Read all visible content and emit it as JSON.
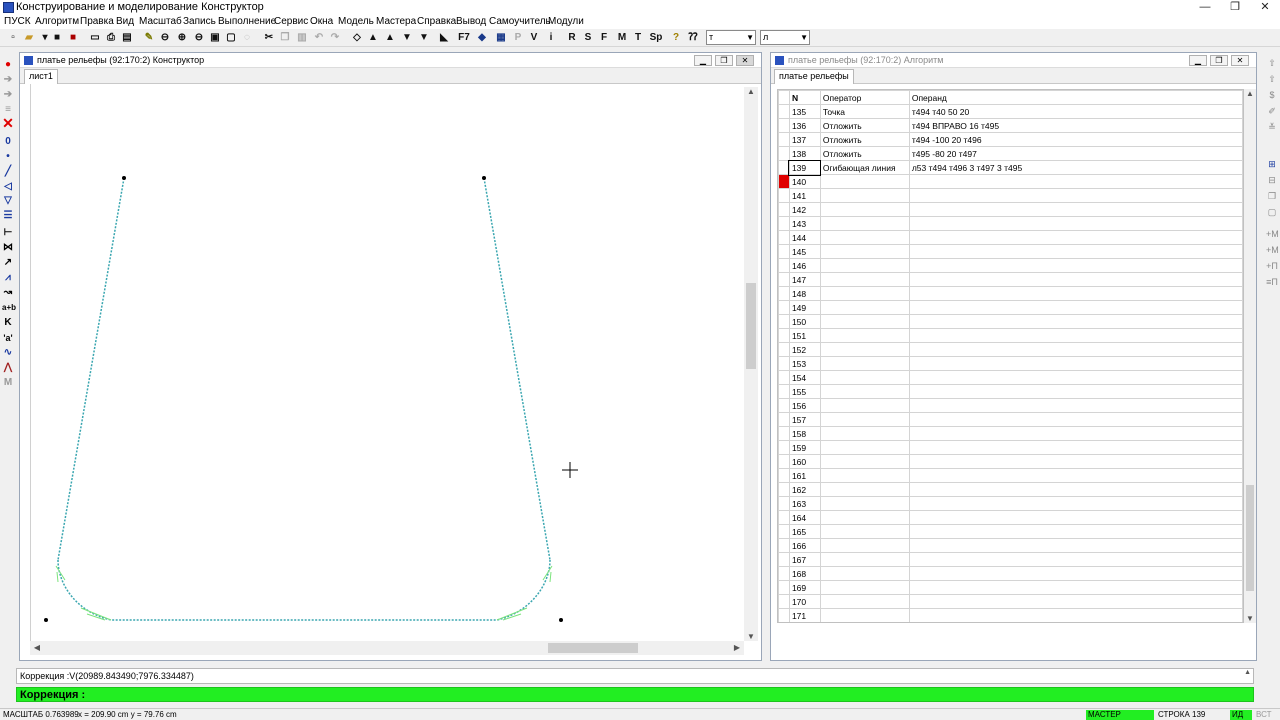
{
  "app": {
    "title": "Конструирование и моделирование  Конструктор"
  },
  "window_controls": {
    "minimize": "—",
    "restore": "❐",
    "close": "✕"
  },
  "menu": [
    "ПУСК",
    "Алгоритм",
    "Правка",
    "Вид",
    "Масштаб",
    "Запись",
    "Выполнение",
    "Сервис",
    "Окна",
    "Модель",
    "Мастера",
    "Справка",
    "Вывод",
    "Самоучитель",
    "Модули"
  ],
  "toolbar": {
    "letters": [
      "F7",
      "P",
      "V",
      "i",
      "R",
      "S",
      "F",
      "M",
      "T",
      "Sp"
    ],
    "select1": "т",
    "select2": "л"
  },
  "left_window": {
    "title": "платье рельефы (92:170:2) Конструктор",
    "tab": "лист1"
  },
  "right_window": {
    "title": "платье рельефы (92:170:2) Алгоритм",
    "tab": "платье рельефы",
    "columns": [
      "N",
      "Оператор",
      "Операнд"
    ],
    "rows": [
      {
        "n": "135",
        "op": "Точка",
        "operand": "т494 т40 50 20"
      },
      {
        "n": "136",
        "op": "Отложить",
        "operand": "т494 ВПРАВО 16 т495"
      },
      {
        "n": "137",
        "op": "Отложить",
        "operand": "т494 -100 20 т496"
      },
      {
        "n": "138",
        "op": "Отложить",
        "operand": "т495 -80 20 т497"
      },
      {
        "n": "139",
        "op": "Огибающая линия",
        "operand": "л53 т494 т496 3 т497 3 т495"
      },
      {
        "n": "140",
        "op": "",
        "operand": ""
      },
      {
        "n": "141",
        "op": "",
        "operand": ""
      },
      {
        "n": "142",
        "op": "",
        "operand": ""
      },
      {
        "n": "143",
        "op": "",
        "operand": ""
      },
      {
        "n": "144",
        "op": "",
        "operand": ""
      },
      {
        "n": "145",
        "op": "",
        "operand": ""
      },
      {
        "n": "146",
        "op": "",
        "operand": ""
      },
      {
        "n": "147",
        "op": "",
        "operand": ""
      },
      {
        "n": "148",
        "op": "",
        "operand": ""
      },
      {
        "n": "149",
        "op": "",
        "operand": ""
      },
      {
        "n": "150",
        "op": "",
        "operand": ""
      },
      {
        "n": "151",
        "op": "",
        "operand": ""
      },
      {
        "n": "152",
        "op": "",
        "operand": ""
      },
      {
        "n": "153",
        "op": "",
        "operand": ""
      },
      {
        "n": "154",
        "op": "",
        "operand": ""
      },
      {
        "n": "155",
        "op": "",
        "operand": ""
      },
      {
        "n": "156",
        "op": "",
        "operand": ""
      },
      {
        "n": "157",
        "op": "",
        "operand": ""
      },
      {
        "n": "158",
        "op": "",
        "operand": ""
      },
      {
        "n": "159",
        "op": "",
        "operand": ""
      },
      {
        "n": "160",
        "op": "",
        "operand": ""
      },
      {
        "n": "161",
        "op": "",
        "operand": ""
      },
      {
        "n": "162",
        "op": "",
        "operand": ""
      },
      {
        "n": "163",
        "op": "",
        "operand": ""
      },
      {
        "n": "164",
        "op": "",
        "operand": ""
      },
      {
        "n": "165",
        "op": "",
        "operand": ""
      },
      {
        "n": "166",
        "op": "",
        "operand": ""
      },
      {
        "n": "167",
        "op": "",
        "operand": ""
      },
      {
        "n": "168",
        "op": "",
        "operand": ""
      },
      {
        "n": "169",
        "op": "",
        "operand": ""
      },
      {
        "n": "170",
        "op": "",
        "operand": ""
      },
      {
        "n": "171",
        "op": "",
        "operand": ""
      }
    ]
  },
  "command": {
    "line1": "Коррекция :V(20989.843490;7976.334487)",
    "line2": "Коррекция :"
  },
  "status": {
    "scale": "МАСШТАБ 0.763989",
    "coords": "x = 209.90 cm  y = 79.76 cm",
    "master": "МАСТЕР",
    "row": "СТРОКА 139",
    "ind1": "ИД",
    "ind2": "ВСТ"
  },
  "colors": {
    "accent_green": "#22ee22",
    "curve": "#3aa6b0",
    "marker": "#e00000"
  }
}
